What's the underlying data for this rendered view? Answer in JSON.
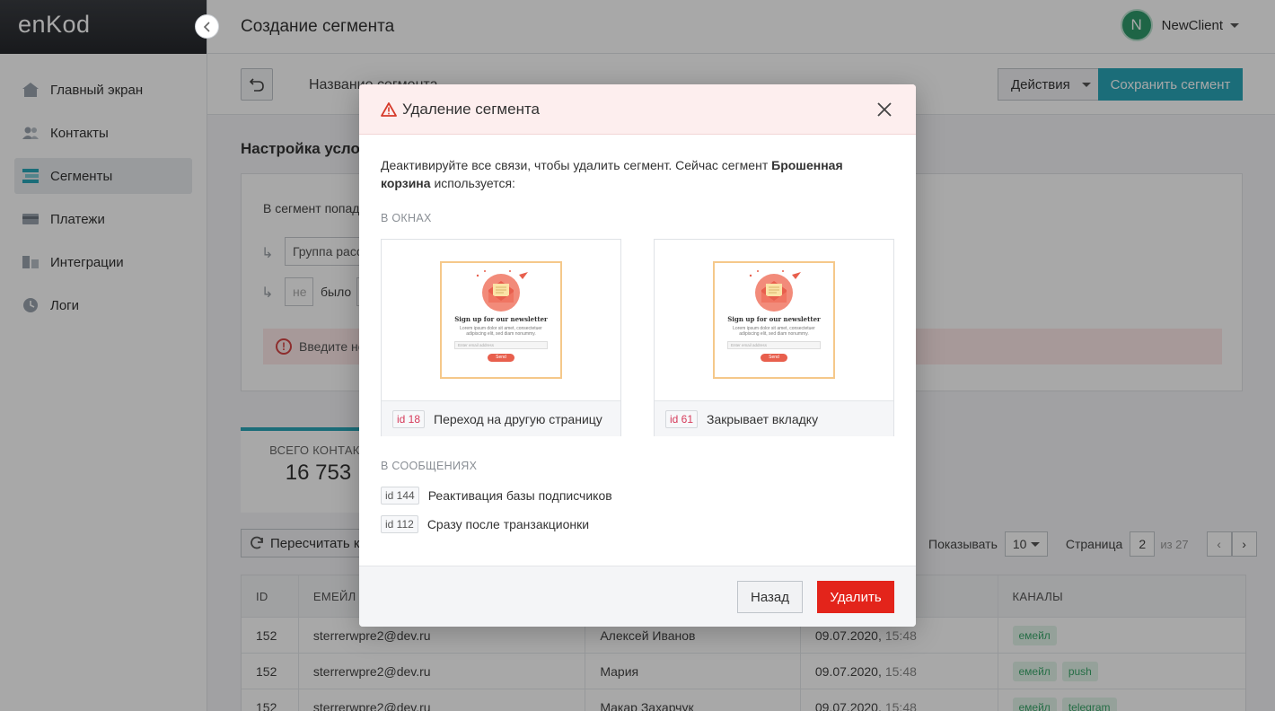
{
  "app": {
    "logo": "enKod",
    "page_title": "Создание сегмента",
    "user": {
      "initial": "N",
      "name": "NewClient",
      "avatar_color": "#2e9a6b"
    }
  },
  "sidebar": {
    "items": [
      {
        "label": "Главный экран",
        "icon": "home-icon"
      },
      {
        "label": "Контакты",
        "icon": "contacts-icon"
      },
      {
        "label": "Сегменты",
        "icon": "segments-icon",
        "active": true
      },
      {
        "label": "Платежи",
        "icon": "card-icon"
      },
      {
        "label": "Интеграции",
        "icon": "integrations-icon"
      },
      {
        "label": "Логи",
        "icon": "logs-icon"
      }
    ]
  },
  "toolbar": {
    "segment_name": "Название сегмента",
    "actions_label": "Действия",
    "save_label": "Сохранить сегмент",
    "save_color": "#2aa6b8"
  },
  "conditions": {
    "title": "Настройка услови",
    "intro": "В сегмент попад",
    "group_field": "Группа расс",
    "not_field": "не",
    "was_label": "было",
    "error_text": "Введите не"
  },
  "stats": {
    "label": "ВСЕГО КОНТАКТ",
    "value": "16 753"
  },
  "list_controls": {
    "recalc_label": "Пересчитать ко",
    "show_label": "Показывать",
    "per_page": "10",
    "page_label": "Страница",
    "page": "2",
    "of_pages": "из 27"
  },
  "table": {
    "headers": [
      "ID",
      "ЕМЕЙЛ",
      "",
      "ИЯ",
      "КАНАЛЫ"
    ],
    "rows": [
      {
        "id": "152",
        "email": "sterrerwpre2@dev.ru",
        "name": "Алексей Иванов",
        "date": "09.07.2020,",
        "time": "15:48",
        "channels": [
          "емейл"
        ]
      },
      {
        "id": "152",
        "email": "sterrerwpre2@dev.ru",
        "name": "Мария",
        "date": "09.07.2020,",
        "time": "15:48",
        "channels": [
          "емейл",
          "push"
        ]
      },
      {
        "id": "152",
        "email": "sterrerwpre2@dev.ru",
        "name": "Макар Захарчук",
        "date": "09.07.2020,",
        "time": "15:48",
        "channels": [
          "емейл",
          "telegram"
        ]
      }
    ]
  },
  "modal": {
    "title": "Удаление сегмента",
    "message_before": "Деактивируйте все связи, чтобы удалить сегмент. Сейчас сегмент ",
    "segment_bold": "Брошенная корзина",
    "message_after": " используется:",
    "windows_section": "В ОКНАХ",
    "windows": [
      {
        "id": "id 18",
        "label": "Переход на другую страницу"
      },
      {
        "id": "id 61",
        "label": "Закрывает вкладку"
      }
    ],
    "newsletter": {
      "title": "Sign up for our newsletter",
      "text": "Lorem ipsum dolor sit amet, consectetuer adipiscing elit, sed diam nonummy.",
      "placeholder": "Enter email address",
      "button": "Send"
    },
    "messages_section": "В СООБЩЕНИЯХ",
    "messages": [
      {
        "id": "id 144",
        "label": "Реактивация базы подписчиков"
      },
      {
        "id": "id 112",
        "label": "Сразу после транзакционки"
      }
    ],
    "back_label": "Назад",
    "delete_label": "Удалить",
    "delete_color": "#e3241b",
    "warning_color": "#d63a2a"
  }
}
